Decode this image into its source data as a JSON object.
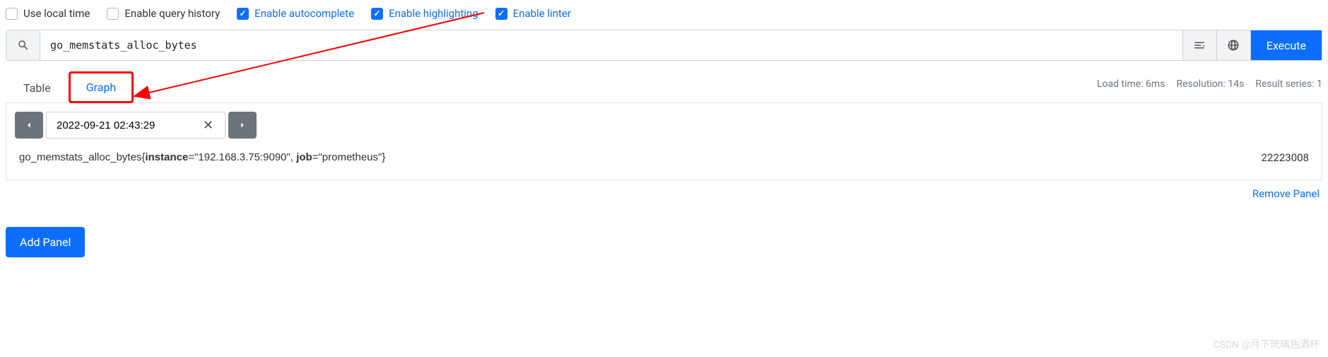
{
  "options": {
    "use_local_time": {
      "label": "Use local time",
      "checked": false
    },
    "enable_query_history": {
      "label": "Enable query history",
      "checked": false
    },
    "enable_autocomplete": {
      "label": "Enable autocomplete",
      "checked": true
    },
    "enable_highlighting": {
      "label": "Enable highlighting",
      "checked": true
    },
    "enable_linter": {
      "label": "Enable linter",
      "checked": true
    }
  },
  "query": {
    "expression": "go_memstats_alloc_bytes",
    "execute_label": "Execute"
  },
  "tabs": {
    "table": "Table",
    "graph": "Graph"
  },
  "stats": {
    "load_time": "Load time: 6ms",
    "resolution": "Resolution: 14s",
    "result_series": "Result series: 1"
  },
  "time_nav": {
    "timestamp": "2022-09-21 02:43:29"
  },
  "result": {
    "metric_name": "go_memstats_alloc_bytes",
    "instance_key": "instance",
    "instance_val": "\"192.168.3.75:9090\"",
    "job_key": "job",
    "job_val": "\"prometheus\"",
    "value": "22223008"
  },
  "actions": {
    "remove_panel": "Remove Panel",
    "add_panel": "Add Panel"
  },
  "watermark": "CSDN @月下琉璃色酒杯"
}
